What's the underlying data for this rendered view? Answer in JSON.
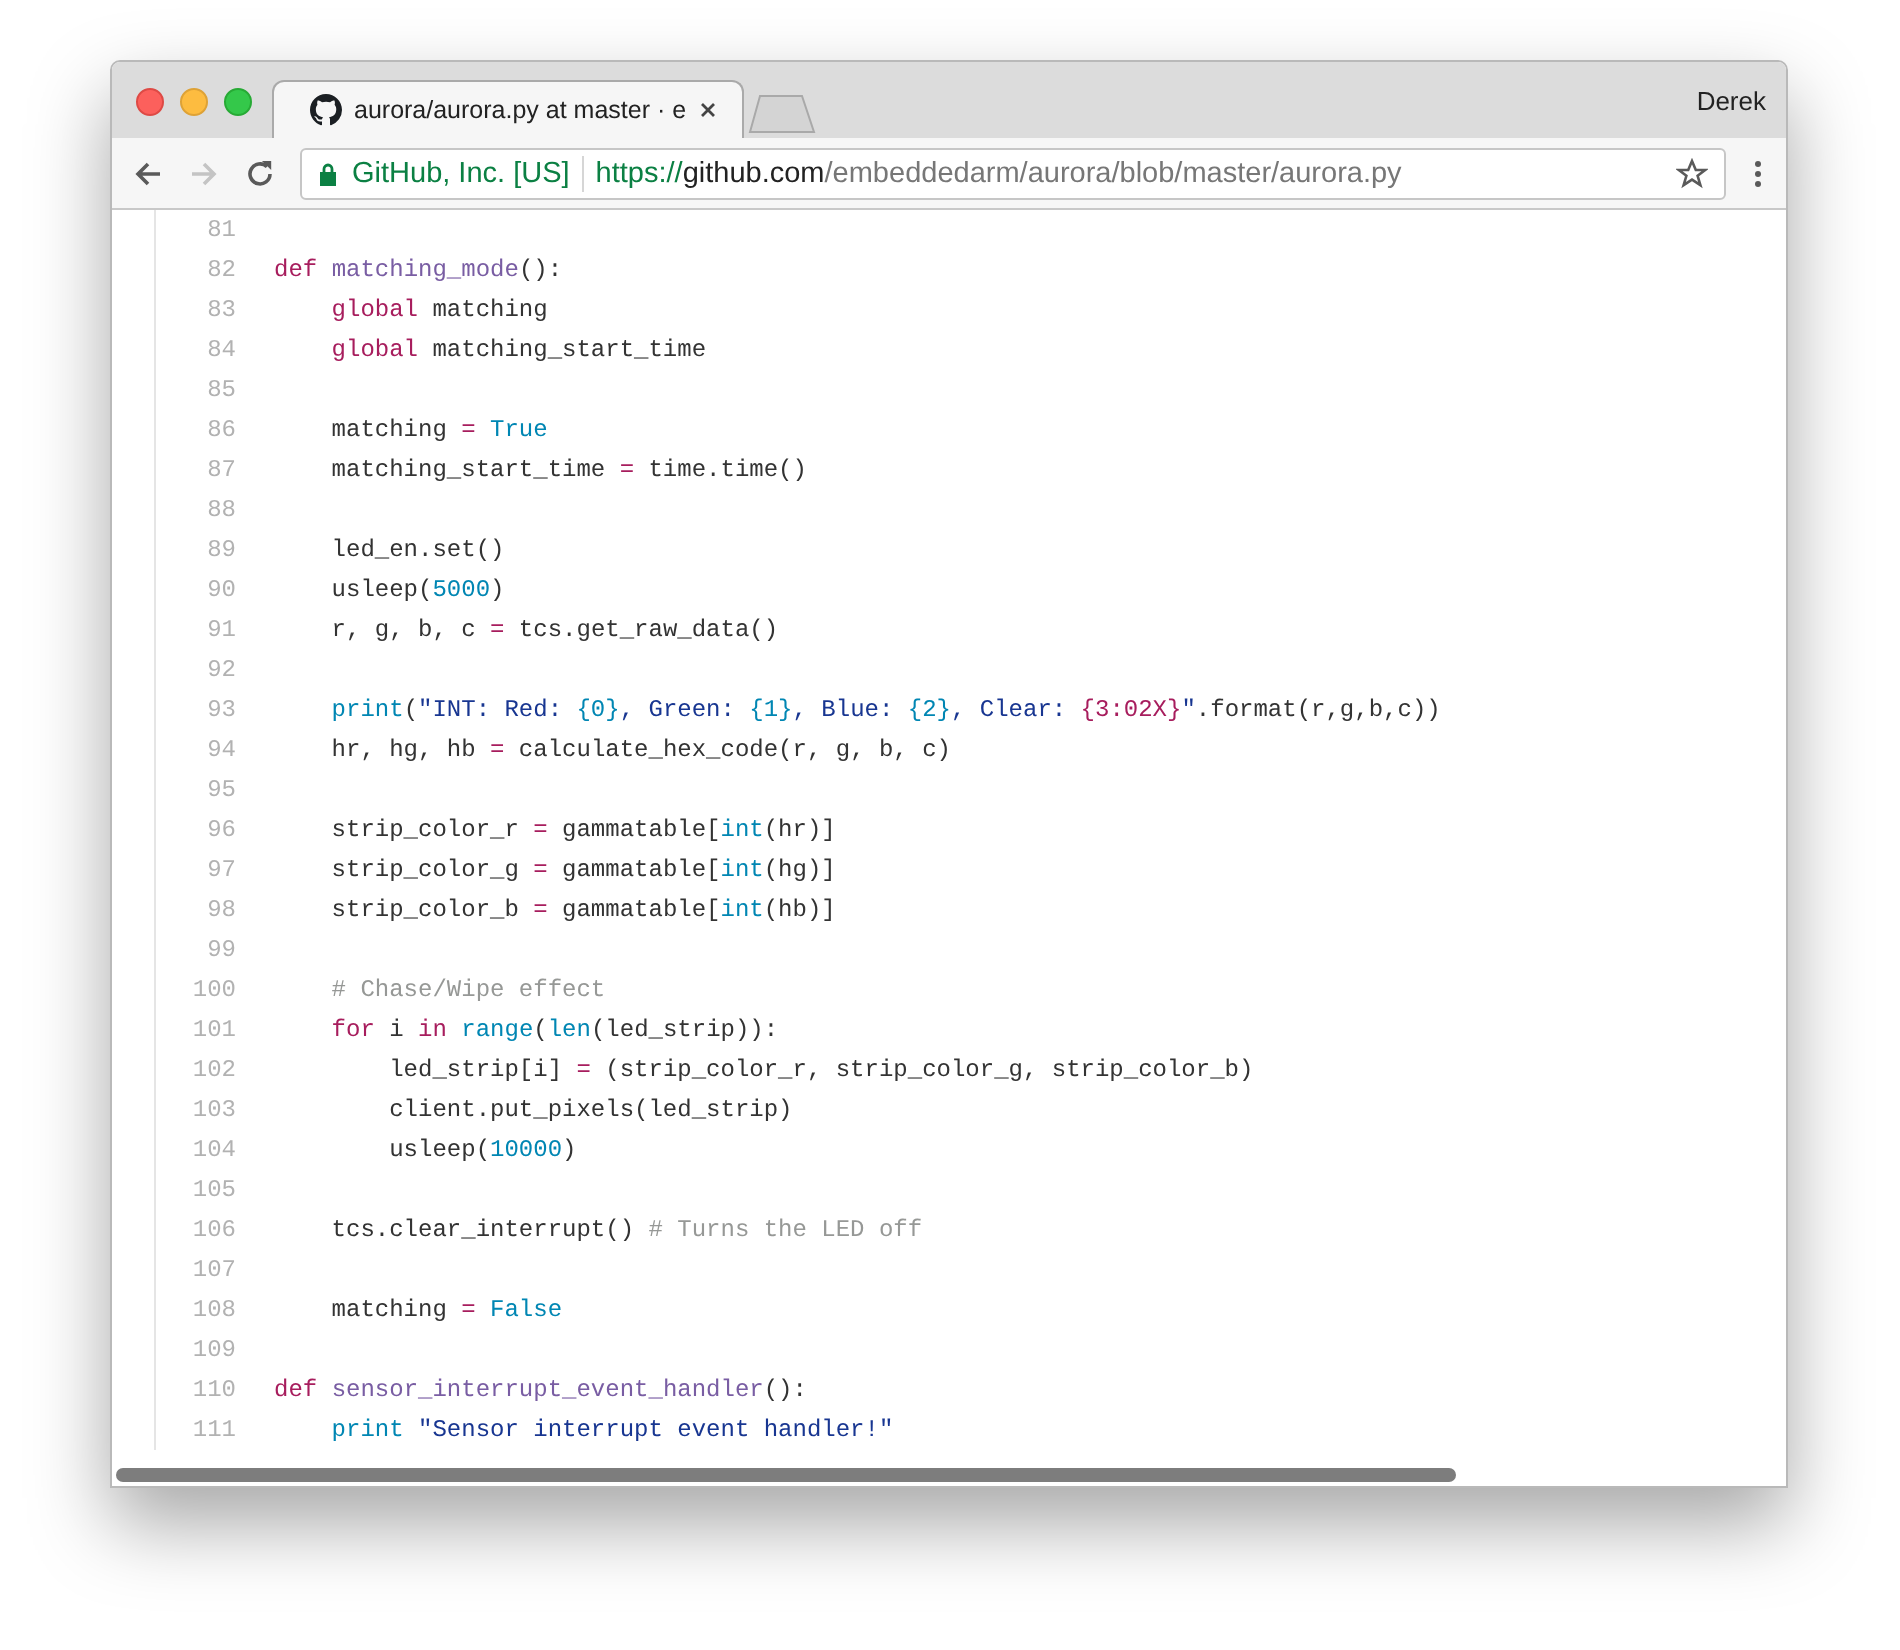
{
  "browser": {
    "user": "Derek",
    "tabs": [
      {
        "title": "aurora/aurora.py at master · e",
        "selected": true
      }
    ],
    "back_disabled": false,
    "forward_disabled": true,
    "security_label": "GitHub, Inc. [US]",
    "url": {
      "scheme": "https://",
      "host": "github.com",
      "path": "/embeddedarm/aurora/blob/master/aurora.py"
    },
    "bookmarked": false
  },
  "code": {
    "lines": [
      {
        "number": "81"
      },
      {
        "number": "82",
        "tokens": [
          {
            "kind": "keyword",
            "text": "def "
          },
          {
            "kind": "function",
            "text": "matching_mode"
          },
          {
            "kind": "plain",
            "text": "():"
          }
        ]
      },
      {
        "number": "83",
        "tokens": [
          {
            "kind": "keyword",
            "text": "    global"
          },
          {
            "kind": "plain",
            "text": " matching"
          }
        ]
      },
      {
        "number": "84",
        "tokens": [
          {
            "kind": "keyword",
            "text": "    global"
          },
          {
            "kind": "plain",
            "text": " matching_start_time"
          }
        ]
      },
      {
        "number": "85"
      },
      {
        "number": "86",
        "tokens": [
          {
            "kind": "plain",
            "text": "    matching "
          },
          {
            "kind": "keyword",
            "text": "="
          },
          {
            "kind": "constant",
            "text": " True"
          }
        ]
      },
      {
        "number": "87",
        "tokens": [
          {
            "kind": "plain",
            "text": "    matching_start_time "
          },
          {
            "kind": "keyword",
            "text": "="
          },
          {
            "kind": "plain",
            "text": " time.time()"
          }
        ]
      },
      {
        "number": "88"
      },
      {
        "number": "89",
        "tokens": [
          {
            "kind": "plain",
            "text": "    led_en.set()"
          }
        ]
      },
      {
        "number": "90",
        "tokens": [
          {
            "kind": "plain",
            "text": "    usleep("
          },
          {
            "kind": "constant",
            "text": "5000"
          },
          {
            "kind": "plain",
            "text": ")"
          }
        ]
      },
      {
        "number": "91",
        "tokens": [
          {
            "kind": "plain",
            "text": "    r, g, b, c "
          },
          {
            "kind": "keyword",
            "text": "="
          },
          {
            "kind": "plain",
            "text": " tcs.get_raw_data()"
          }
        ]
      },
      {
        "number": "92"
      },
      {
        "number": "93",
        "tokens": [
          {
            "kind": "constant",
            "text": "    print"
          },
          {
            "kind": "plain",
            "text": "("
          },
          {
            "kind": "string",
            "text": "\"INT: Red: "
          },
          {
            "kind": "constant",
            "text": "{0}"
          },
          {
            "kind": "string",
            "text": ", Green: "
          },
          {
            "kind": "constant",
            "text": "{1}"
          },
          {
            "kind": "string",
            "text": ", Blue: "
          },
          {
            "kind": "constant",
            "text": "{2}"
          },
          {
            "kind": "string",
            "text": ", Clear: "
          },
          {
            "kind": "keyword",
            "text": "{3:02X}"
          },
          {
            "kind": "string",
            "text": "\""
          },
          {
            "kind": "plain",
            "text": ".format(r,g,b,c))"
          }
        ]
      },
      {
        "number": "94",
        "tokens": [
          {
            "kind": "plain",
            "text": "    hr, hg, hb "
          },
          {
            "kind": "keyword",
            "text": "="
          },
          {
            "kind": "plain",
            "text": " calculate_hex_code(r, g, b, c)"
          }
        ]
      },
      {
        "number": "95"
      },
      {
        "number": "96",
        "tokens": [
          {
            "kind": "plain",
            "text": "    strip_color_r "
          },
          {
            "kind": "keyword",
            "text": "="
          },
          {
            "kind": "plain",
            "text": " gammatable["
          },
          {
            "kind": "constant",
            "text": "int"
          },
          {
            "kind": "plain",
            "text": "(hr)]"
          }
        ]
      },
      {
        "number": "97",
        "tokens": [
          {
            "kind": "plain",
            "text": "    strip_color_g "
          },
          {
            "kind": "keyword",
            "text": "="
          },
          {
            "kind": "plain",
            "text": " gammatable["
          },
          {
            "kind": "constant",
            "text": "int"
          },
          {
            "kind": "plain",
            "text": "(hg)]"
          }
        ]
      },
      {
        "number": "98",
        "tokens": [
          {
            "kind": "plain",
            "text": "    strip_color_b "
          },
          {
            "kind": "keyword",
            "text": "="
          },
          {
            "kind": "plain",
            "text": " gammatable["
          },
          {
            "kind": "constant",
            "text": "int"
          },
          {
            "kind": "plain",
            "text": "(hb)]"
          }
        ]
      },
      {
        "number": "99"
      },
      {
        "number": "100",
        "tokens": [
          {
            "kind": "comment",
            "text": "    # Chase/Wipe effect"
          }
        ]
      },
      {
        "number": "101",
        "tokens": [
          {
            "kind": "keyword",
            "text": "    for"
          },
          {
            "kind": "plain",
            "text": " i "
          },
          {
            "kind": "keyword",
            "text": "in"
          },
          {
            "kind": "constant",
            "text": " range"
          },
          {
            "kind": "plain",
            "text": "("
          },
          {
            "kind": "constant",
            "text": "len"
          },
          {
            "kind": "plain",
            "text": "(led_strip)):"
          }
        ]
      },
      {
        "number": "102",
        "tokens": [
          {
            "kind": "plain",
            "text": "        led_strip[i] "
          },
          {
            "kind": "keyword",
            "text": "="
          },
          {
            "kind": "plain",
            "text": " (strip_color_r, strip_color_g, strip_color_b)"
          }
        ]
      },
      {
        "number": "103",
        "tokens": [
          {
            "kind": "plain",
            "text": "        client.put_pixels(led_strip)"
          }
        ]
      },
      {
        "number": "104",
        "tokens": [
          {
            "kind": "plain",
            "text": "        usleep("
          },
          {
            "kind": "constant",
            "text": "10000"
          },
          {
            "kind": "plain",
            "text": ")"
          }
        ]
      },
      {
        "number": "105"
      },
      {
        "number": "106",
        "tokens": [
          {
            "kind": "plain",
            "text": "    tcs.clear_interrupt() "
          },
          {
            "kind": "comment",
            "text": "# Turns the LED off"
          }
        ]
      },
      {
        "number": "107"
      },
      {
        "number": "108",
        "tokens": [
          {
            "kind": "plain",
            "text": "    matching "
          },
          {
            "kind": "keyword",
            "text": "="
          },
          {
            "kind": "constant",
            "text": " False"
          }
        ]
      },
      {
        "number": "109"
      },
      {
        "number": "110",
        "tokens": [
          {
            "kind": "keyword",
            "text": "def "
          },
          {
            "kind": "function",
            "text": "sensor_interrupt_event_handler"
          },
          {
            "kind": "plain",
            "text": "():"
          }
        ]
      },
      {
        "number": "111",
        "tokens": [
          {
            "kind": "constant",
            "text": "    print"
          },
          {
            "kind": "string",
            "text": " \"Sensor interrupt event handler!\""
          }
        ]
      }
    ]
  }
}
